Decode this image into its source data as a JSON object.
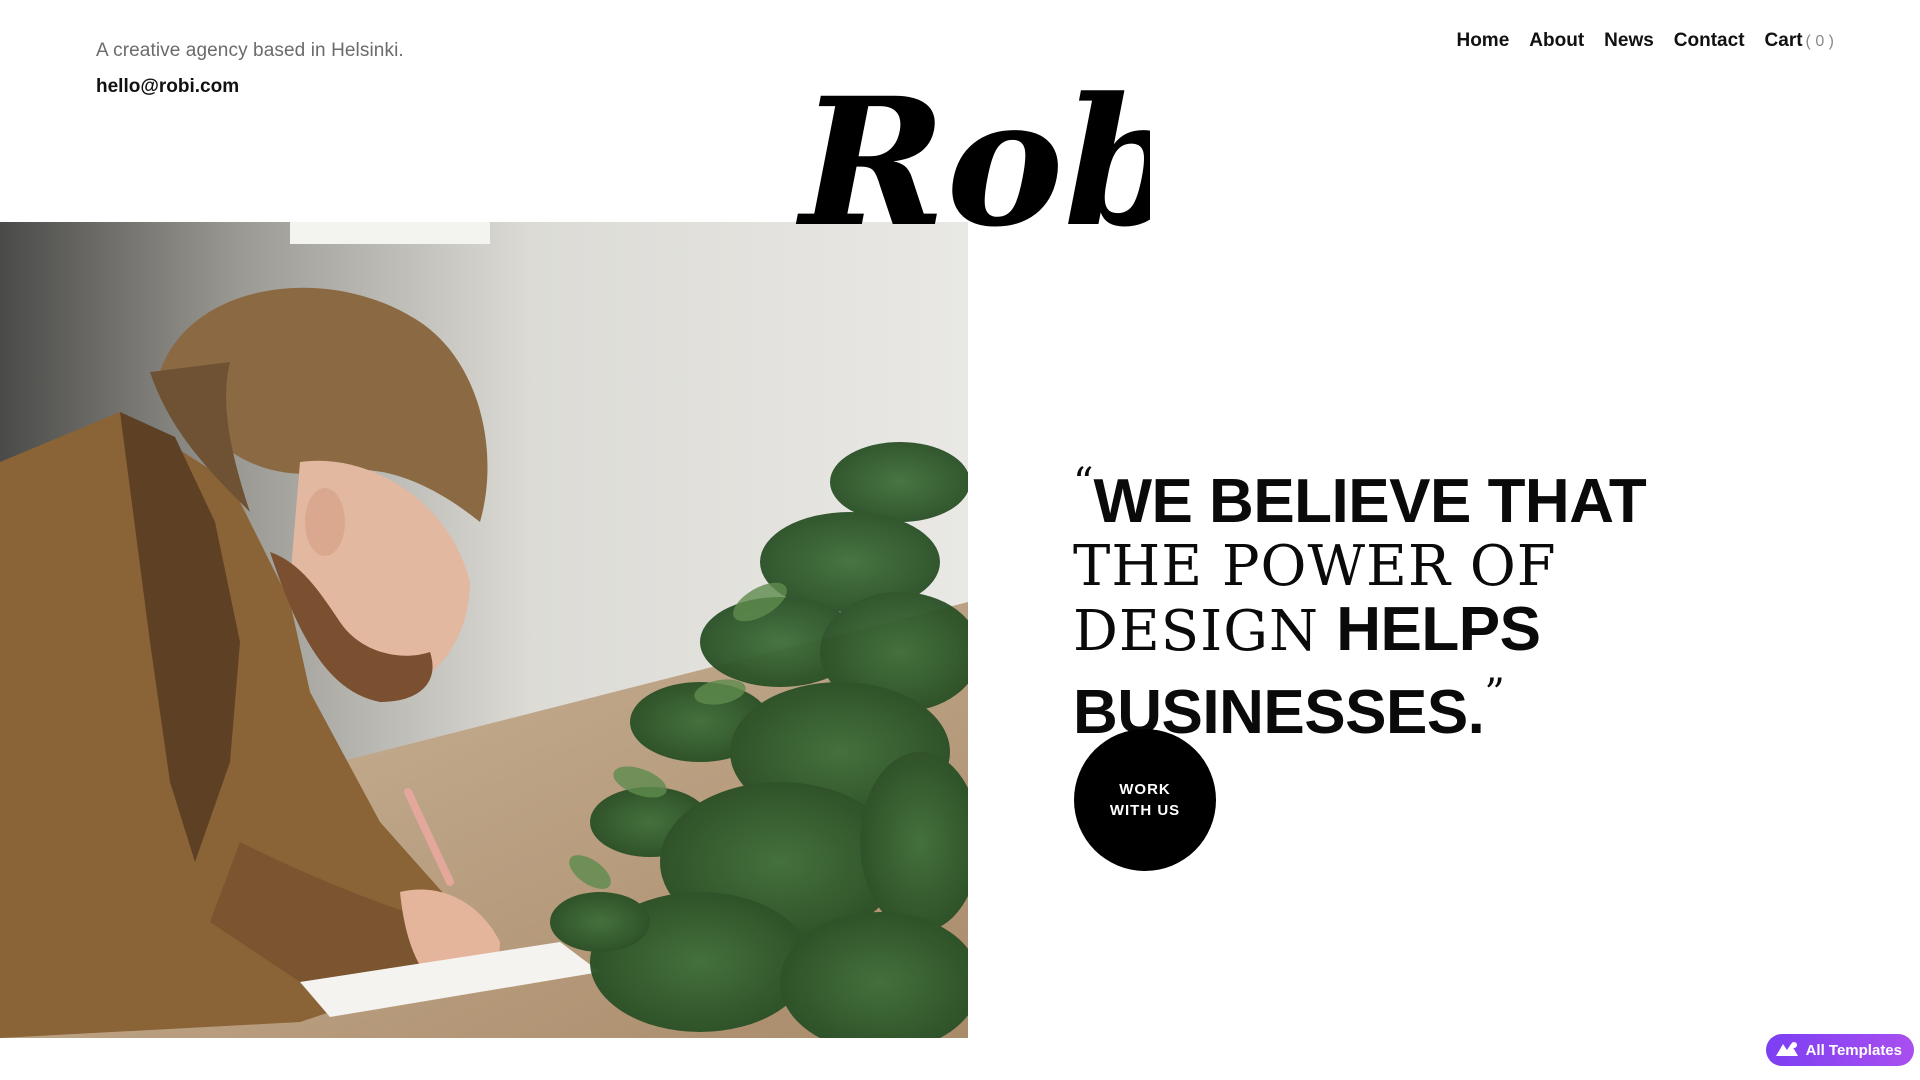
{
  "header": {
    "tagline": "A creative agency based in Helsinki.",
    "email": "hello@robi.com"
  },
  "nav": {
    "items": [
      {
        "label": "Home"
      },
      {
        "label": "About"
      },
      {
        "label": "News"
      },
      {
        "label": "Contact"
      }
    ],
    "cart_label": "Cart",
    "cart_count": "( 0 )"
  },
  "logo": {
    "text": "Roby"
  },
  "hero": {
    "quote_open": "“",
    "quote_part1": "WE BELIEVE THAT",
    "quote_part2": "THE POWER OF DESIGN",
    "quote_part3": "HELPS BUSINESSES.",
    "quote_close": "”",
    "cta_label": "WORK\nWITH US"
  },
  "badge": {
    "label": "All Templates",
    "icon": "templates-icon"
  },
  "colors": {
    "background": "#ffffff",
    "text": "#111111",
    "muted": "#6b6b6b",
    "cta_bg": "#000000",
    "badge_start": "#7b3ff2",
    "badge_end": "#a94ff0"
  }
}
